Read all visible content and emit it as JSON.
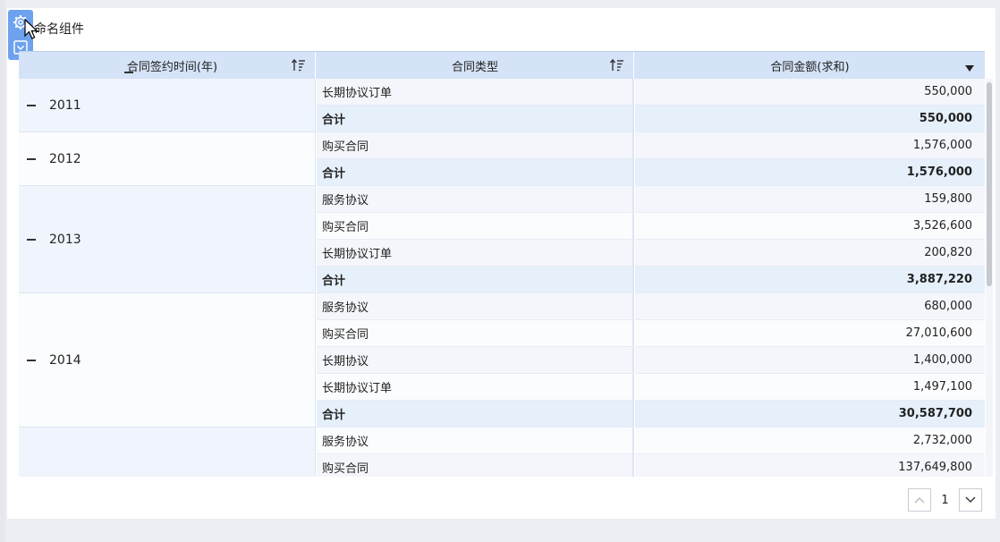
{
  "widget": {
    "title": "命名组件"
  },
  "table": {
    "headers": {
      "col1": "合同签约时间(年)",
      "col2": "合同类型",
      "col3": "合同金额(求和)"
    },
    "groups": [
      {
        "year": "2011",
        "rows": [
          {
            "type": "长期协议订单",
            "amount": "550,000"
          },
          {
            "type": "合计",
            "amount": "550,000",
            "total": true
          }
        ]
      },
      {
        "year": "2012",
        "rows": [
          {
            "type": "购买合同",
            "amount": "1,576,000"
          },
          {
            "type": "合计",
            "amount": "1,576,000",
            "total": true
          }
        ]
      },
      {
        "year": "2013",
        "rows": [
          {
            "type": "服务协议",
            "amount": "159,800"
          },
          {
            "type": "购买合同",
            "amount": "3,526,600"
          },
          {
            "type": "长期协议订单",
            "amount": "200,820"
          },
          {
            "type": "合计",
            "amount": "3,887,220",
            "total": true
          }
        ]
      },
      {
        "year": "2014",
        "rows": [
          {
            "type": "服务协议",
            "amount": "680,000"
          },
          {
            "type": "购买合同",
            "amount": "27,010,600"
          },
          {
            "type": "长期协议",
            "amount": "1,400,000"
          },
          {
            "type": "长期协议订单",
            "amount": "1,497,100"
          },
          {
            "type": "合计",
            "amount": "30,587,700",
            "total": true
          }
        ]
      },
      {
        "year": "",
        "rows": [
          {
            "type": "服务协议",
            "amount": "2,732,000"
          },
          {
            "type": "购买合同",
            "amount": "137,649,800"
          }
        ]
      }
    ]
  },
  "pager": {
    "page": "1"
  },
  "icons": {
    "settings": "gear-icon",
    "collapse": "chevron-down-box-icon",
    "sort": "sort-icon",
    "dropdown": "caret-down-icon"
  },
  "colors": {
    "accent": "#6ea2ee",
    "header_bg": "#d4e3f7",
    "total_bg": "#e6f0fb"
  }
}
